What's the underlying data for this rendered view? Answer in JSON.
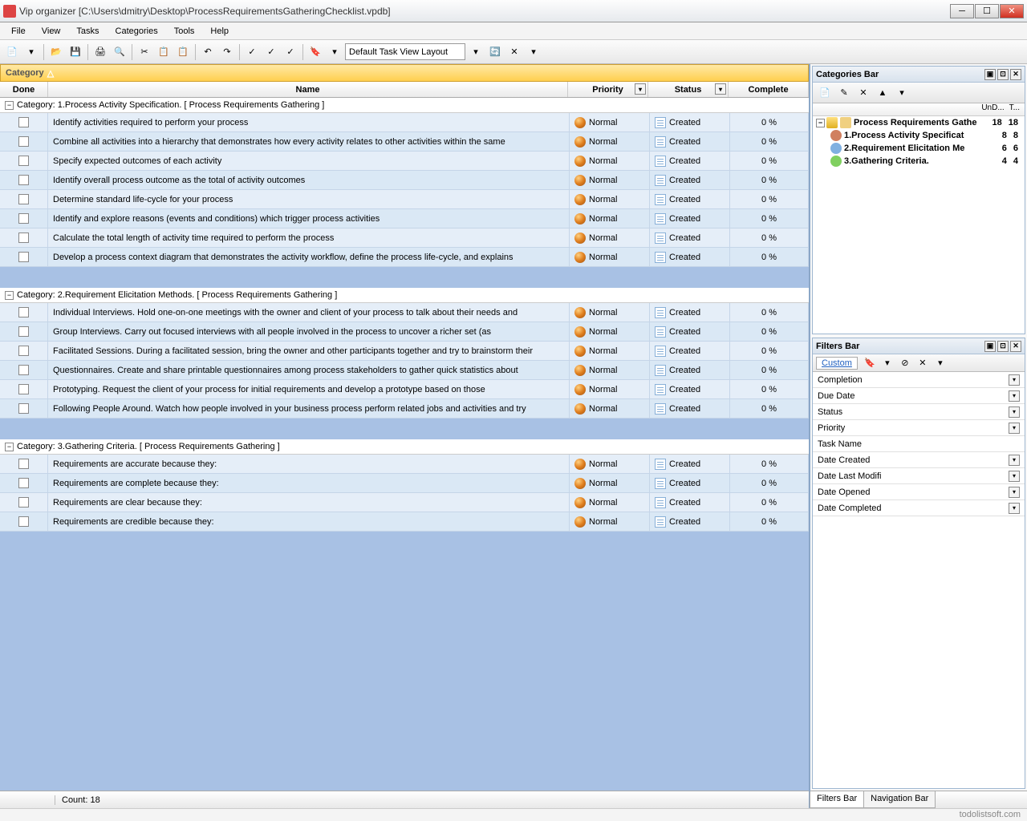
{
  "window": {
    "title": "Vip organizer [C:\\Users\\dmitry\\Desktop\\ProcessRequirementsGatheringChecklist.vpdb]"
  },
  "menu": [
    "File",
    "View",
    "Tasks",
    "Categories",
    "Tools",
    "Help"
  ],
  "toolbar": {
    "layout_label": "Default Task View Layout"
  },
  "category_bar": {
    "label": "Category"
  },
  "columns": {
    "done": "Done",
    "name": "Name",
    "priority": "Priority",
    "status": "Status",
    "complete": "Complete"
  },
  "groups": [
    {
      "header": "Category: 1.Process Activity Specification.     [ Process Requirements Gathering  ]",
      "tasks": [
        {
          "name": "Identify activities required to perform your process",
          "priority": "Normal",
          "status": "Created",
          "complete": "0 %"
        },
        {
          "name": "Combine all activities into a hierarchy that demonstrates how every activity relates to other activities within the same",
          "priority": "Normal",
          "status": "Created",
          "complete": "0 %"
        },
        {
          "name": "Specify expected outcomes of each activity",
          "priority": "Normal",
          "status": "Created",
          "complete": "0 %"
        },
        {
          "name": "Identify overall process outcome as the total of activity outcomes",
          "priority": "Normal",
          "status": "Created",
          "complete": "0 %"
        },
        {
          "name": "Determine standard life-cycle for your process",
          "priority": "Normal",
          "status": "Created",
          "complete": "0 %"
        },
        {
          "name": "Identify and explore reasons (events and conditions) which trigger process activities",
          "priority": "Normal",
          "status": "Created",
          "complete": "0 %"
        },
        {
          "name": "Calculate the total length of activity time required to perform the process",
          "priority": "Normal",
          "status": "Created",
          "complete": "0 %"
        },
        {
          "name": "Develop a process context diagram that demonstrates the activity workflow, define the process life-cycle, and explains",
          "priority": "Normal",
          "status": "Created",
          "complete": "0 %"
        }
      ]
    },
    {
      "header": "Category: 2.Requirement Elicitation Methods.     [ Process Requirements Gathering  ]",
      "tasks": [
        {
          "name": "Individual Interviews. Hold one-on-one meetings with the owner and client of your process to talk about their needs and",
          "priority": "Normal",
          "status": "Created",
          "complete": "0 %"
        },
        {
          "name": "Group Interviews. Carry out focused interviews with all people involved in the process to uncover a richer set (as",
          "priority": "Normal",
          "status": "Created",
          "complete": "0 %"
        },
        {
          "name": "Facilitated Sessions. During a facilitated session, bring the owner and other participants together and try to brainstorm their",
          "priority": "Normal",
          "status": "Created",
          "complete": "0 %"
        },
        {
          "name": "Questionnaires. Create and share printable questionnaires among process stakeholders to gather quick statistics about",
          "priority": "Normal",
          "status": "Created",
          "complete": "0 %"
        },
        {
          "name": "Prototyping. Request the client of your process for initial requirements and develop a prototype based on those",
          "priority": "Normal",
          "status": "Created",
          "complete": "0 %"
        },
        {
          "name": "Following People Around. Watch how people involved in your business process perform related jobs and activities and try",
          "priority": "Normal",
          "status": "Created",
          "complete": "0 %"
        }
      ]
    },
    {
      "header": "Category: 3.Gathering Criteria.     [ Process Requirements Gathering  ]",
      "tasks": [
        {
          "name": "Requirements are accurate because they:",
          "priority": "Normal",
          "status": "Created",
          "complete": "0 %"
        },
        {
          "name": "Requirements are complete because they:",
          "priority": "Normal",
          "status": "Created",
          "complete": "0 %"
        },
        {
          "name": "Requirements are clear because they:",
          "priority": "Normal",
          "status": "Created",
          "complete": "0 %"
        },
        {
          "name": "Requirements are credible because they:",
          "priority": "Normal",
          "status": "Created",
          "complete": "0 %"
        }
      ]
    }
  ],
  "footer": {
    "count_label": "Count:  18"
  },
  "categories_panel": {
    "title": "Categories Bar",
    "header_cols": [
      "UnD...",
      "T..."
    ],
    "tree": [
      {
        "icon": "doc",
        "label": "Process Requirements Gathe",
        "n1": "18",
        "n2": "18",
        "bold": true,
        "indent": 0,
        "exp": true
      },
      {
        "icon": "people",
        "label": "1.Process Activity Specificat",
        "n1": "8",
        "n2": "8",
        "bold": true,
        "indent": 1
      },
      {
        "icon": "clock",
        "label": "2.Requirement Elicitation Me",
        "n1": "6",
        "n2": "6",
        "bold": true,
        "indent": 1
      },
      {
        "icon": "smile",
        "label": "3.Gathering Criteria.",
        "n1": "4",
        "n2": "4",
        "bold": true,
        "indent": 1
      }
    ]
  },
  "filters_panel": {
    "title": "Filters Bar",
    "custom": "Custom",
    "items": [
      "Completion",
      "Due Date",
      "Status",
      "Priority",
      "Task Name",
      "Date Created",
      "Date Last Modifi",
      "Date Opened",
      "Date Completed"
    ]
  },
  "right_tabs": [
    "Filters Bar",
    "Navigation Bar"
  ],
  "watermark": "todolistsoft.com"
}
